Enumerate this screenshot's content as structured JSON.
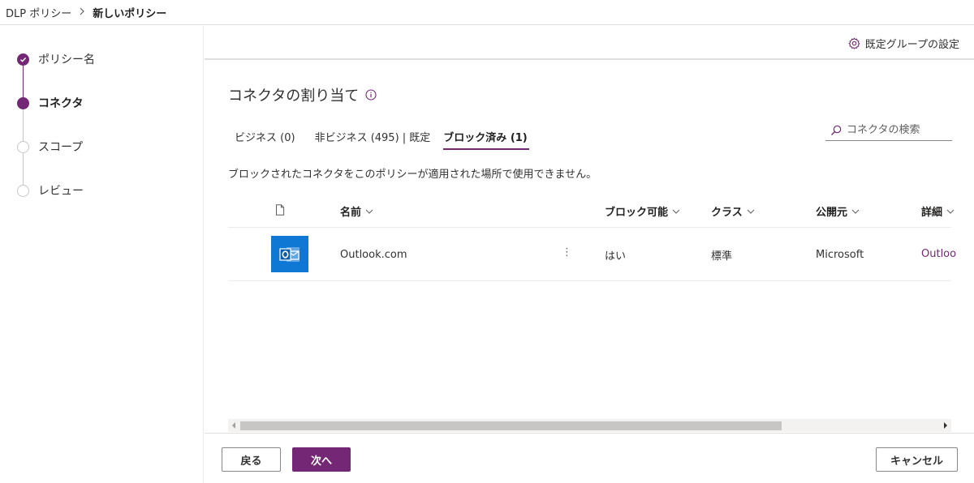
{
  "breadcrumb": {
    "root": "DLP ポリシー",
    "current": "新しいポリシー"
  },
  "stepper": {
    "steps": [
      {
        "label": "ポリシー名",
        "state": "done"
      },
      {
        "label": "コネクタ",
        "state": "active"
      },
      {
        "label": "スコープ",
        "state": "todo"
      },
      {
        "label": "レビュー",
        "state": "todo"
      }
    ]
  },
  "commandbar": {
    "settings_label": "既定グループの設定",
    "settings_icon": "gear-icon"
  },
  "main": {
    "title": "コネクタの割り当て",
    "title_icon": "info-icon",
    "tabs": [
      {
        "label": "ビジネス (0)"
      },
      {
        "label": "非ビジネス (495) | 既定"
      },
      {
        "label": "ブロック済み (1)",
        "selected": true
      }
    ],
    "search": {
      "placeholder": "コネクタの検索",
      "value": ""
    },
    "description": "ブロックされたコネクタをこのポリシーが適用された場所で使用できません。"
  },
  "table": {
    "columns": {
      "name": "名前",
      "blockable": "ブロック可能",
      "class": "クラス",
      "publisher": "公開元",
      "details": "詳細"
    },
    "rows": [
      {
        "icon": "outlook-icon",
        "name": "Outlook.com",
        "blockable": "はい",
        "class": "標準",
        "publisher": "Microsoft",
        "details": "Outloo"
      }
    ]
  },
  "footer": {
    "back_label": "戻る",
    "next_label": "次へ",
    "cancel_label": "キャンセル"
  },
  "colors": {
    "accent": "#742774",
    "outlook": "#0f78d4"
  }
}
